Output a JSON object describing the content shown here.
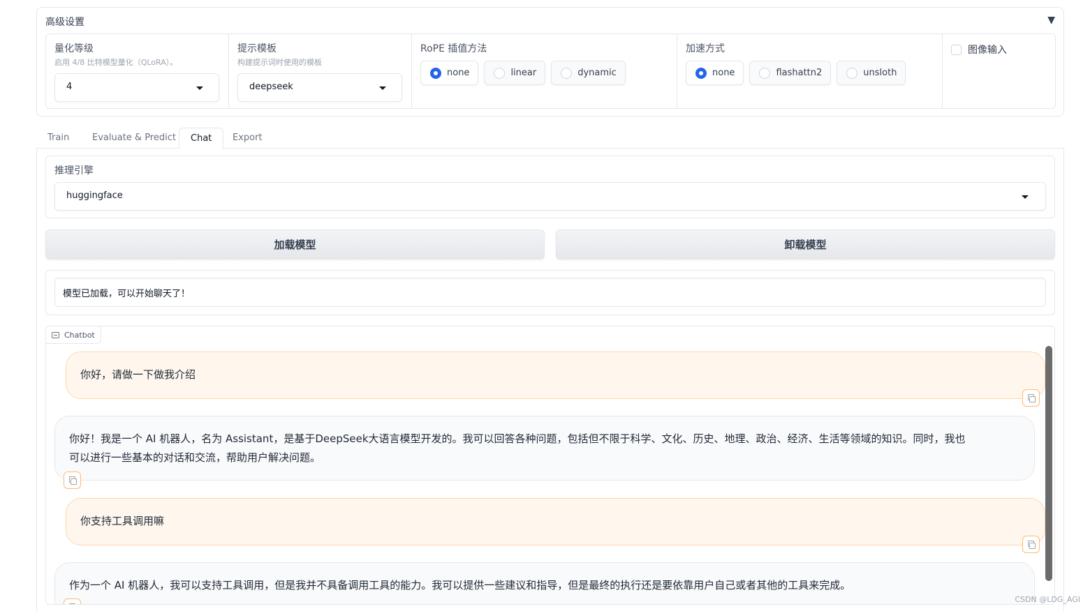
{
  "advanced": {
    "title": "高级设置",
    "caret": "▼",
    "quant": {
      "label": "量化等级",
      "info": "启用 4/8 比特模型量化（QLoRA）。",
      "value": "4"
    },
    "template": {
      "label": "提示模板",
      "info": "构建提示词时使用的模板",
      "value": "deepseek"
    },
    "rope": {
      "label": "RoPE 插值方法",
      "options": [
        "none",
        "linear",
        "dynamic"
      ],
      "selected": "none"
    },
    "accel": {
      "label": "加速方式",
      "options": [
        "none",
        "flashattn2",
        "unsloth"
      ],
      "selected": "none"
    },
    "image_input": {
      "label": "图像输入",
      "checked": false
    }
  },
  "tabs": [
    "Train",
    "Evaluate & Predict",
    "Chat",
    "Export"
  ],
  "active_tab": "Chat",
  "engine": {
    "label": "推理引擎",
    "value": "huggingface"
  },
  "buttons": {
    "load": "加载模型",
    "unload": "卸载模型"
  },
  "status": {
    "value": "模型已加载，可以开始聊天了！"
  },
  "chatbot": {
    "label": "Chatbot",
    "messages": [
      {
        "role": "user",
        "text": "你好，请做一下做我介绍"
      },
      {
        "role": "bot",
        "line1": "你好！我是一个 AI 机器人，名为 Assistant，是基于DeepSeek大语言模型开发的。我可以回答各种问题，包括但不限于科学、文化、历史、地理、政治、经济、生活等领域的知识。同时，我也",
        "line2": "可以进行一些基本的对话和交流，帮助用户解决问题。"
      },
      {
        "role": "user",
        "text": "你支持工具调用嘛"
      },
      {
        "role": "bot",
        "text": "作为一个 AI 机器人，我可以支持工具调用，但是我并不具备调用工具的能力。我可以提供一些建议和指导，但是最终的执行还是要依靠用户自己或者其他的工具来完成。"
      }
    ]
  },
  "watermark": "CSDN @LDG_AGI",
  "colors": {
    "accent": "#2563eb",
    "user_bubble": "#fff7ed",
    "user_border": "#fed7aa"
  }
}
